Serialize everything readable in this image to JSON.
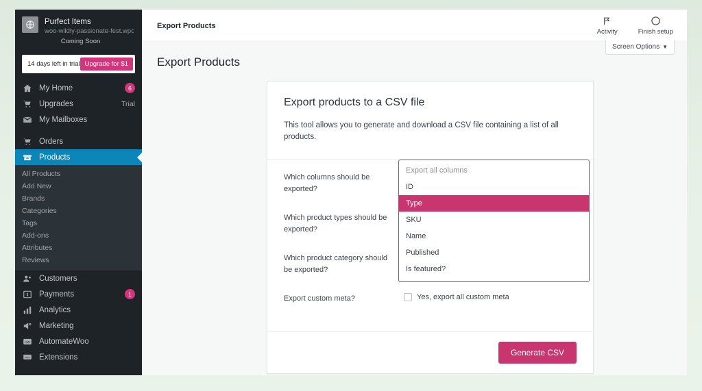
{
  "sidebar": {
    "site": {
      "icon": "globe-icon",
      "title": "Purfect Items",
      "url": "woo-wildly-passionate-fest.wpcoms",
      "status": "Coming Soon"
    },
    "trial": {
      "text": "14 days left in trial",
      "button_label": "Upgrade for $1"
    },
    "primary_items": [
      {
        "label": "My Home",
        "icon": "home-icon",
        "badge": "6",
        "right": ""
      },
      {
        "label": "Upgrades",
        "icon": "cart-icon",
        "badge": "",
        "right": "Trial"
      },
      {
        "label": "My Mailboxes",
        "icon": "mail-icon",
        "badge": "",
        "right": ""
      }
    ],
    "secondary_items": [
      {
        "label": "Orders",
        "icon": "orders-icon",
        "badge": "",
        "right": ""
      }
    ],
    "active_item": {
      "label": "Products",
      "icon": "products-icon"
    },
    "submenu": [
      {
        "label": "All Products"
      },
      {
        "label": "Add New"
      },
      {
        "label": "Brands"
      },
      {
        "label": "Categories"
      },
      {
        "label": "Tags"
      },
      {
        "label": "Add-ons"
      },
      {
        "label": "Attributes"
      },
      {
        "label": "Reviews"
      }
    ],
    "tertiary_items": [
      {
        "label": "Customers",
        "icon": "customers-icon",
        "badge": "",
        "right": ""
      },
      {
        "label": "Payments",
        "icon": "payments-icon",
        "badge": "1",
        "right": ""
      },
      {
        "label": "Analytics",
        "icon": "analytics-icon",
        "badge": "",
        "right": ""
      },
      {
        "label": "Marketing",
        "icon": "marketing-icon",
        "badge": "",
        "right": ""
      },
      {
        "label": "AutomateWoo",
        "icon": "automatewoo-icon",
        "badge": "",
        "right": ""
      },
      {
        "label": "Extensions",
        "icon": "extensions-icon",
        "badge": "",
        "right": ""
      }
    ]
  },
  "adminbar": {
    "title": "Export Products",
    "actions": [
      {
        "label": "Activity",
        "icon": "flag-icon"
      },
      {
        "label": "Finish setup",
        "icon": "progress-circle-icon"
      }
    ],
    "screen_options_label": "Screen Options",
    "screen_options_caret": "▼"
  },
  "page": {
    "title": "Export Products"
  },
  "card": {
    "title": "Export products to a CSV file",
    "description": "This tool allows you to generate and download a CSV file containing a list of all products.",
    "rows": [
      {
        "label": "Which columns should be exported?"
      },
      {
        "label": "Which product types should be exported?"
      },
      {
        "label": "Which product category should be exported?"
      },
      {
        "label": "Export custom meta?"
      }
    ],
    "custom_meta_checkbox_label": "Yes, export all custom meta",
    "generate_button_label": "Generate CSV"
  },
  "dropdown": {
    "options": [
      {
        "label": "Export all columns",
        "state": "placeholder"
      },
      {
        "label": "ID",
        "state": "normal"
      },
      {
        "label": "Type",
        "state": "selected"
      },
      {
        "label": "SKU",
        "state": "normal"
      },
      {
        "label": "Name",
        "state": "normal"
      },
      {
        "label": "Published",
        "state": "normal"
      },
      {
        "label": "Is featured?",
        "state": "normal"
      }
    ]
  },
  "colors": {
    "accent_pink": "#c9356e",
    "trial_pink": "#d1367a",
    "sidebar_bg": "#1d2327",
    "submenu_bg": "#2c3338",
    "active_blue": "#0c85b8",
    "page_bg": "#f6f7f7",
    "outer_bg": "#e6efe6"
  }
}
